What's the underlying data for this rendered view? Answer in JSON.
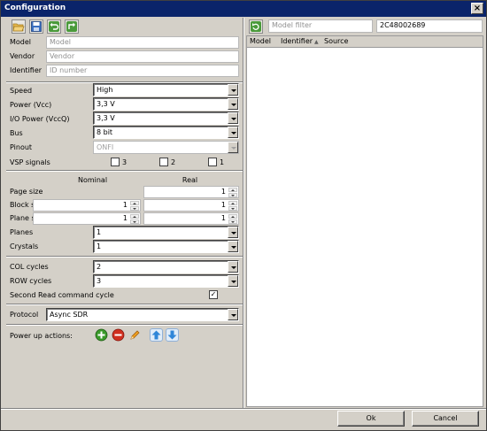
{
  "window": {
    "title": "Configuration",
    "close_glyph": "×"
  },
  "toolbar": [
    "open-folder-icon",
    "save-icon",
    "undo-icon",
    "export-icon"
  ],
  "fields": {
    "model": {
      "label": "Model",
      "placeholder": "Model"
    },
    "vendor": {
      "label": "Vendor",
      "placeholder": "Vendor"
    },
    "identifier": {
      "label": "Identifier",
      "placeholder": "ID number"
    }
  },
  "settings": {
    "speed": {
      "label": "Speed",
      "value": "High"
    },
    "power": {
      "label": "Power (Vcc)",
      "value": "3,3 V"
    },
    "io_power": {
      "label": "I/O Power (VccQ)",
      "value": "3,3 V"
    },
    "bus": {
      "label": "Bus",
      "value": "8 bit"
    },
    "pinout": {
      "label": "Pinout",
      "value": "ONFI"
    },
    "vsp": {
      "label": "VSP signals",
      "options": [
        "3",
        "2",
        "1"
      ]
    }
  },
  "geometry": {
    "nominal_header": "Nominal",
    "real_header": "Real",
    "page_size": {
      "label": "Page size",
      "real": "1"
    },
    "block_size": {
      "label": "Block size",
      "nominal": "1",
      "real": "1"
    },
    "plane_size": {
      "label": "Plane size",
      "nominal": "1",
      "real": "1"
    },
    "planes": {
      "label": "Planes",
      "value": "1"
    },
    "crystals": {
      "label": "Crystals",
      "value": "1"
    }
  },
  "cycles": {
    "col": {
      "label": "COL cycles",
      "value": "2"
    },
    "row": {
      "label": "ROW cycles",
      "value": "3"
    },
    "second_read": {
      "label": "Second Read command cycle",
      "checked": "✓"
    }
  },
  "protocol": {
    "label": "Protocol",
    "value": "Async SDR"
  },
  "power_up": {
    "label": "Power up actions:",
    "buttons": [
      "add-icon",
      "remove-icon",
      "edit-icon",
      "move-up-icon",
      "move-down-icon"
    ]
  },
  "filter": {
    "placeholder": "Model filter",
    "id_value": "2C48002689"
  },
  "table": {
    "columns": [
      "Model",
      "Identifier",
      "Source"
    ],
    "sort_glyph": "▲"
  },
  "footer": {
    "ok": "Ok",
    "cancel": "Cancel"
  },
  "colors": {
    "title_bar": "#0a246a",
    "dialog_bg": "#d4d0c8",
    "add_green": "#3a9a2a",
    "remove_red": "#d03020",
    "arrow_blue": "#2f86d8"
  }
}
